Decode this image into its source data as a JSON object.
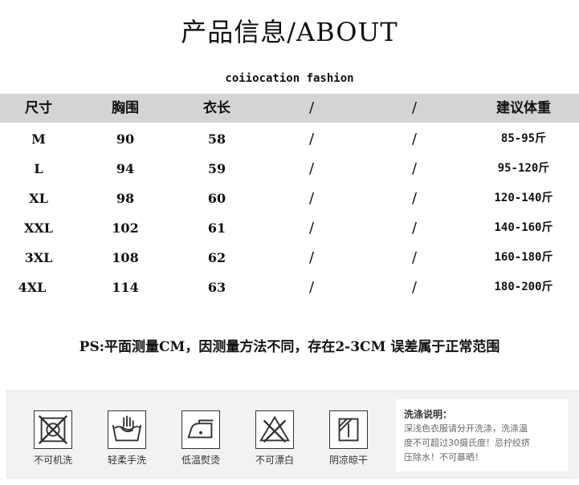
{
  "title": "产品信息/ABOUT",
  "subtitle": "coiiocation fashion",
  "table": {
    "headers": [
      "尺寸",
      "胸围",
      "衣长",
      "/",
      "/",
      "建议体重"
    ],
    "rows": [
      [
        "M",
        "90",
        "58",
        "/",
        "/",
        "85-95斤"
      ],
      [
        "L",
        "94",
        "59",
        "/",
        "/",
        "95-120斤"
      ],
      [
        "XL",
        "98",
        "60",
        "/",
        "/",
        "120-140斤"
      ],
      [
        "XXL",
        "102",
        "61",
        "/",
        "/",
        "140-160斤"
      ],
      [
        "3XL",
        "108",
        "62",
        "/",
        "/",
        "160-180斤"
      ],
      [
        "4XL",
        "114",
        "63",
        "/",
        "/",
        "180-200斤"
      ]
    ]
  },
  "ps_note": "PS:平面测量CM，因测量方法不同，存在2-3CM 误差属于正常范围",
  "care": {
    "items": [
      {
        "icon": "no-machine-wash-icon",
        "label": "不可机洗"
      },
      {
        "icon": "gentle-hand-wash-icon",
        "label": "轻柔手洗"
      },
      {
        "icon": "low-temp-iron-icon",
        "label": "低温熨烫"
      },
      {
        "icon": "no-bleach-icon",
        "label": "不可漂白"
      },
      {
        "icon": "shade-dry-icon",
        "label": "阴凉晾干"
      }
    ],
    "note_title": "洗涤说明：",
    "note_lines": [
      "深浅色衣服请分开洗涤，洗涤温",
      "度不可超过30摄氏度！忌拧绞挤",
      "压除水！不可暴晒！"
    ]
  }
}
